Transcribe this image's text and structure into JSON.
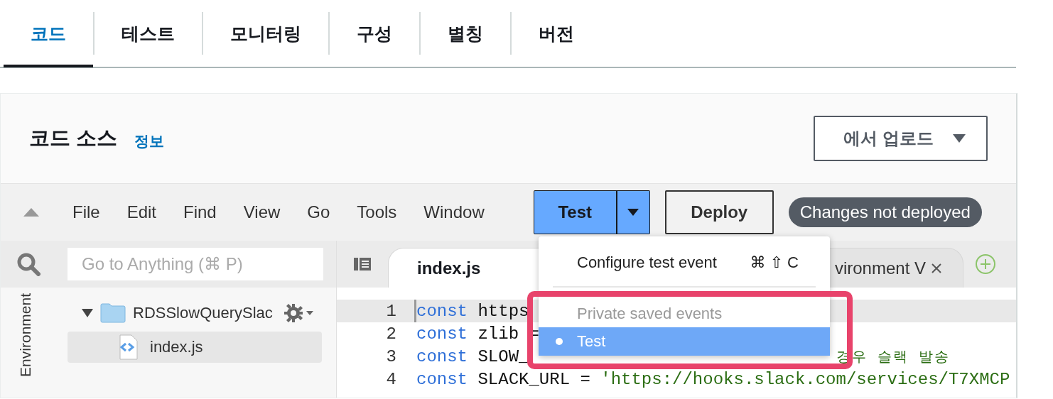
{
  "tabs": [
    {
      "label": "코드",
      "selected": true
    },
    {
      "label": "테스트",
      "selected": false
    },
    {
      "label": "모니터링",
      "selected": false
    },
    {
      "label": "구성",
      "selected": false
    },
    {
      "label": "별칭",
      "selected": false
    },
    {
      "label": "버전",
      "selected": false
    }
  ],
  "section": {
    "title": "코드 소스",
    "info_link": "정보",
    "upload_button": "에서 업로드"
  },
  "toolbar": {
    "menus": [
      "File",
      "Edit",
      "Find",
      "View",
      "Go",
      "Tools",
      "Window"
    ],
    "test_button": "Test",
    "deploy_button": "Deploy",
    "status_badge": "Changes not deployed"
  },
  "sidebar": {
    "search_placeholder": "Go to Anything (⌘ P)",
    "panel_label": "Environment",
    "tree": [
      {
        "label": "RDSSlowQuerySlac",
        "kind": "folder",
        "expanded": true,
        "selected": false,
        "children": [
          {
            "label": "index.js",
            "kind": "file",
            "selected": true
          }
        ]
      }
    ]
  },
  "editor": {
    "tabs": [
      {
        "label": "index.js",
        "selected": true,
        "closable": false
      },
      {
        "label": "vironment V",
        "selected": false,
        "closable": true
      }
    ],
    "lines": [
      {
        "number": "1",
        "current": true,
        "segments": [
          {
            "kind": "keyword",
            "text": "const"
          },
          {
            "kind": "plain",
            "text": " https"
          }
        ]
      },
      {
        "number": "2",
        "current": false,
        "segments": [
          {
            "kind": "keyword",
            "text": "const"
          },
          {
            "kind": "plain",
            "text": " zlib ="
          }
        ]
      },
      {
        "number": "3",
        "current": false,
        "segments": [
          {
            "kind": "keyword",
            "text": "const"
          },
          {
            "kind": "plain",
            "text": " SLOW_"
          },
          {
            "kind": "trailing-comment",
            "text": "경우 슬랙 발송"
          }
        ]
      },
      {
        "number": "4",
        "current": false,
        "segments": [
          {
            "kind": "keyword",
            "text": "const"
          },
          {
            "kind": "plain",
            "text": " SLACK_URL = "
          },
          {
            "kind": "string",
            "text": "'https://hooks.slack.com/services/T7XMCP"
          }
        ]
      }
    ]
  },
  "test_menu": {
    "items": [
      {
        "kind": "command",
        "label": "Configure test event",
        "shortcut": "⌘ ⇧ C"
      },
      {
        "kind": "separator"
      },
      {
        "kind": "header",
        "label": "Private saved events"
      },
      {
        "kind": "event",
        "label": "Test",
        "selected": true
      }
    ]
  }
}
